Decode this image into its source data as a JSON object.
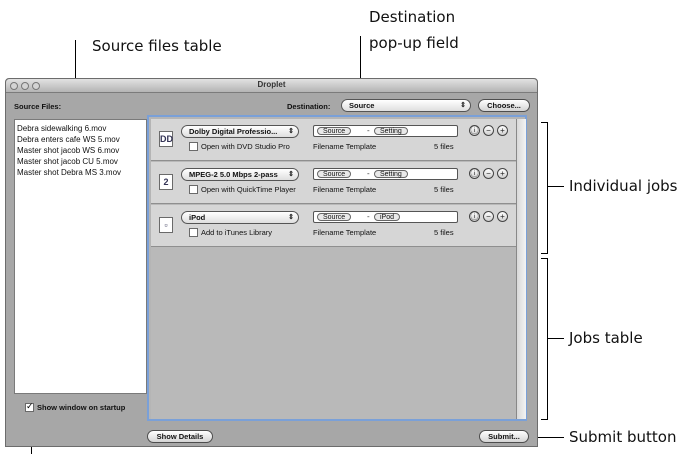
{
  "callouts": {
    "source_files_table": "Source files table",
    "destination_line1": "Destination",
    "destination_line2": "pop-up field",
    "individual_jobs": "Individual jobs",
    "jobs_table": "Jobs table",
    "submit_button": "Submit button"
  },
  "window": {
    "title": "Droplet"
  },
  "source": {
    "label": "Source Files:",
    "files": [
      "Debra sidewalking 6.mov",
      "Debra enters cafe WS 5.mov",
      "Master shot jacob WS 6.mov",
      "Master shot jacob CU 5.mov",
      "Master shot Debra MS 3.mov"
    ]
  },
  "destination": {
    "label": "Destination:",
    "value": "Source",
    "choose_label": "Choose..."
  },
  "jobs": [
    {
      "icon": "dolby-icon",
      "icon_glyph": "DD",
      "setting": "Dolby Digital Professio...",
      "open_with": "Open with DVD Studio Pro",
      "token1": "Source",
      "token2": "Setting",
      "template_label": "Filename Template",
      "count": "5 files"
    },
    {
      "icon": "mpeg2-icon",
      "icon_glyph": "2",
      "setting": "MPEG-2 5.0 Mbps 2-pass",
      "open_with": "Open with QuickTime Player",
      "token1": "Source",
      "token2": "Setting",
      "template_label": "Filename Template",
      "count": "5 files"
    },
    {
      "icon": "ipod-icon",
      "icon_glyph": "▫",
      "setting": "iPod",
      "open_with": "Add to iTunes Library",
      "token1": "Source",
      "token2": "iPod",
      "template_label": "Filename Template",
      "count": "5 files"
    }
  ],
  "footer": {
    "show_window_label": "Show window on startup",
    "show_details_label": "Show Details",
    "submit_label": "Submit..."
  },
  "icons": {
    "info": "ⓘ",
    "minus": "−",
    "plus": "+",
    "popup_arrows": "⇕"
  },
  "colors": {
    "jobs_frame_highlight": "#7aa0d8"
  }
}
